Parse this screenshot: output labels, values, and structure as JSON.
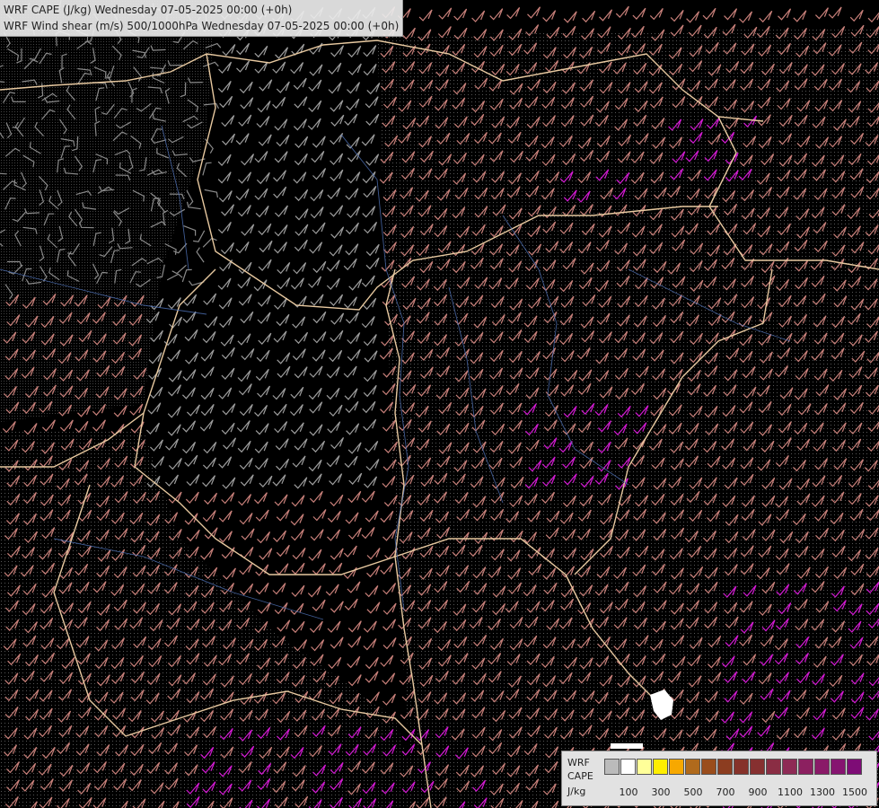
{
  "titles": {
    "cape": "WRF CAPE (J/kg) Wednesday 07-05-2025 00:00 (+0h)",
    "shear": "WRF Wind shear (m/s) 500/1000hPa Wednesday 07-05-2025 00:00 (+0h)"
  },
  "legend": {
    "line1": "WRF",
    "line2": "CAPE",
    "unit": "J/kg",
    "colors": [
      "#bbbbbb",
      "#ffffff",
      "#ffff99",
      "#ffee00",
      "#f7a800",
      "#b06a1c",
      "#9a4d1c",
      "#8c3d20",
      "#86322a",
      "#863030",
      "#8a2d44",
      "#8e2a55",
      "#8c2060",
      "#8a1a68",
      "#861470",
      "#7e0c76"
    ],
    "tick_labels": [
      "100",
      "300",
      "500",
      "700",
      "900",
      "1100",
      "1300",
      "1500"
    ]
  }
}
